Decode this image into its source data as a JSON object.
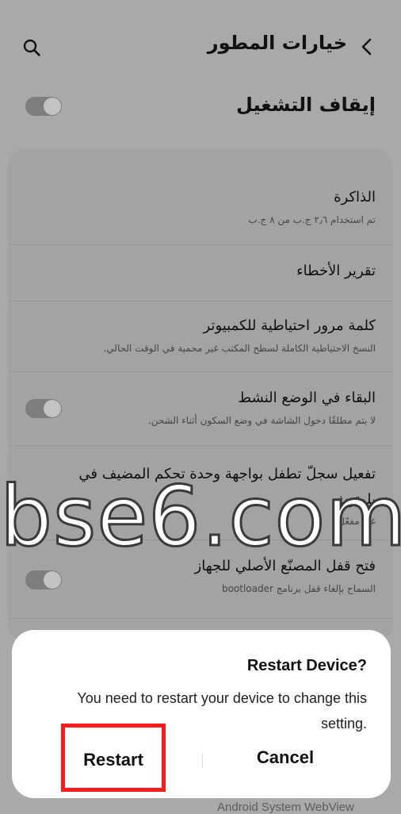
{
  "header": {
    "title": "خيارات المطور",
    "back_icon": "chevron-left-icon",
    "search_icon": "search-icon"
  },
  "master": {
    "label": "إيقاف التشغيل",
    "toggle_state": "on"
  },
  "settings": {
    "memory": {
      "title": "الذاكرة",
      "subtitle": "تم استخدام ٢٫٦ ج.ب من ٨ ج.ب"
    },
    "bug_report": {
      "title": "تقرير الأخطاء"
    },
    "backup_password": {
      "title": "كلمة مرور احتياطية للكمبيوتر",
      "subtitle": "النسخ الاحتياطية الكاملة لسطح المكتب غير محمية في الوقت الحالي."
    },
    "stay_awake": {
      "title": "البقاء في الوضع النشط",
      "subtitle": "لا يتم مطلقًا دخول الشاشة في وضع السكون أثناء الشحن.",
      "toggle_state": "on"
    },
    "bt_hci": {
      "title": "تفعيل سجلّ تطفل بواجهة وحدة تحكم المضيف في بلوتوث",
      "subtitle": "غير مفعّل"
    },
    "oem_unlock": {
      "title": "فتح قفل المصنّع الأصلي للجهاز",
      "subtitle": "السماح بإلغاء قفل برنامج bootloader",
      "toggle_state": "on"
    }
  },
  "watermark": "bse6.com",
  "dialog": {
    "title": "Restart Device?",
    "message": "You need to restart your device to change this setting.",
    "restart_label": "Restart",
    "cancel_label": "Cancel",
    "highlight_color": "#ff1b1b"
  },
  "footer": {
    "text": "Android System WebView"
  }
}
